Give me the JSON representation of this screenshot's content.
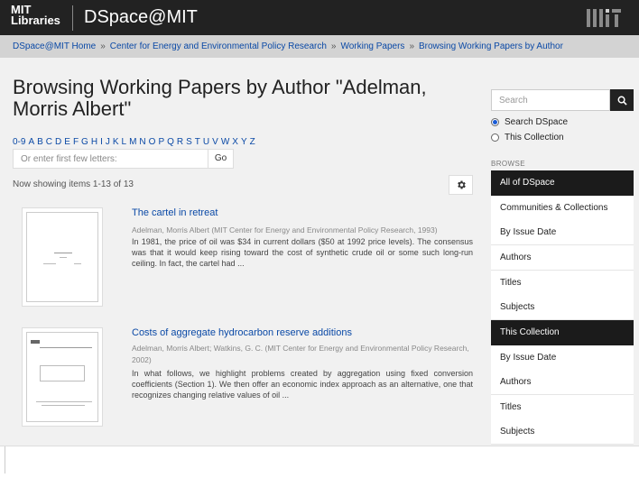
{
  "header": {
    "logo_line1": "MIT",
    "logo_line2": "Libraries",
    "site_title": "DSpace@MIT",
    "brand_icon": "mit-logo-icon"
  },
  "breadcrumb": {
    "items": [
      "DSpace@MIT Home",
      "Center for Energy and Environmental Policy Research",
      "Working Papers",
      "Browsing Working Papers by Author"
    ],
    "separator": "»"
  },
  "main": {
    "title": "Browsing Working Papers by Author \"Adelman, Morris Albert\"",
    "alpha_links": [
      "0-9",
      "A",
      "B",
      "C",
      "D",
      "E",
      "F",
      "G",
      "H",
      "I",
      "J",
      "K",
      "L",
      "M",
      "N",
      "O",
      "P",
      "Q",
      "R",
      "S",
      "T",
      "U",
      "V",
      "W",
      "X",
      "Y",
      "Z"
    ],
    "letters_placeholder": "Or enter first few letters:",
    "go_label": "Go",
    "showing": "Now showing items 1-13 of 13",
    "items": [
      {
        "title": "The cartel in retreat",
        "meta": "Adelman, Morris Albert (MIT Center for Energy and Environmental Policy Research, 1993)",
        "abstract": "In 1981, the price of oil was $34 in current dollars ($50 at 1992 price levels). The consensus was that it would keep rising toward the cost of synthetic crude oil or some such long-run ceiling. In fact, the cartel had ..."
      },
      {
        "title": "Costs of aggregate hydrocarbon reserve additions",
        "meta": "Adelman, Morris Albert; Watkins, G. C. (MIT Center for Energy and Environmental Policy Research, 2002)",
        "abstract": "In what follows, we highlight problems created by aggregation using fixed conversion coefficients (Section 1). We then offer an economic index approach as an alternative, one that recognizes changing relative values of oil ..."
      }
    ]
  },
  "sidebar": {
    "search_placeholder": "Search",
    "scopes": [
      {
        "label": "Search DSpace",
        "selected": true
      },
      {
        "label": "This Collection",
        "selected": false
      }
    ],
    "browse_label": "BROWSE",
    "group1_header": "All of DSpace",
    "group1_items": [
      "Communities & Collections",
      "By Issue Date",
      "Authors",
      "Titles",
      "Subjects"
    ],
    "group2_header": "This Collection",
    "group2_items": [
      "By Issue Date",
      "Authors",
      "Titles",
      "Subjects"
    ]
  },
  "colors": {
    "link": "#0a49a6",
    "header_bg": "#222222",
    "breadcrumb_bg": "#d3d3d3",
    "nav_active_bg": "#1b1b1b"
  }
}
